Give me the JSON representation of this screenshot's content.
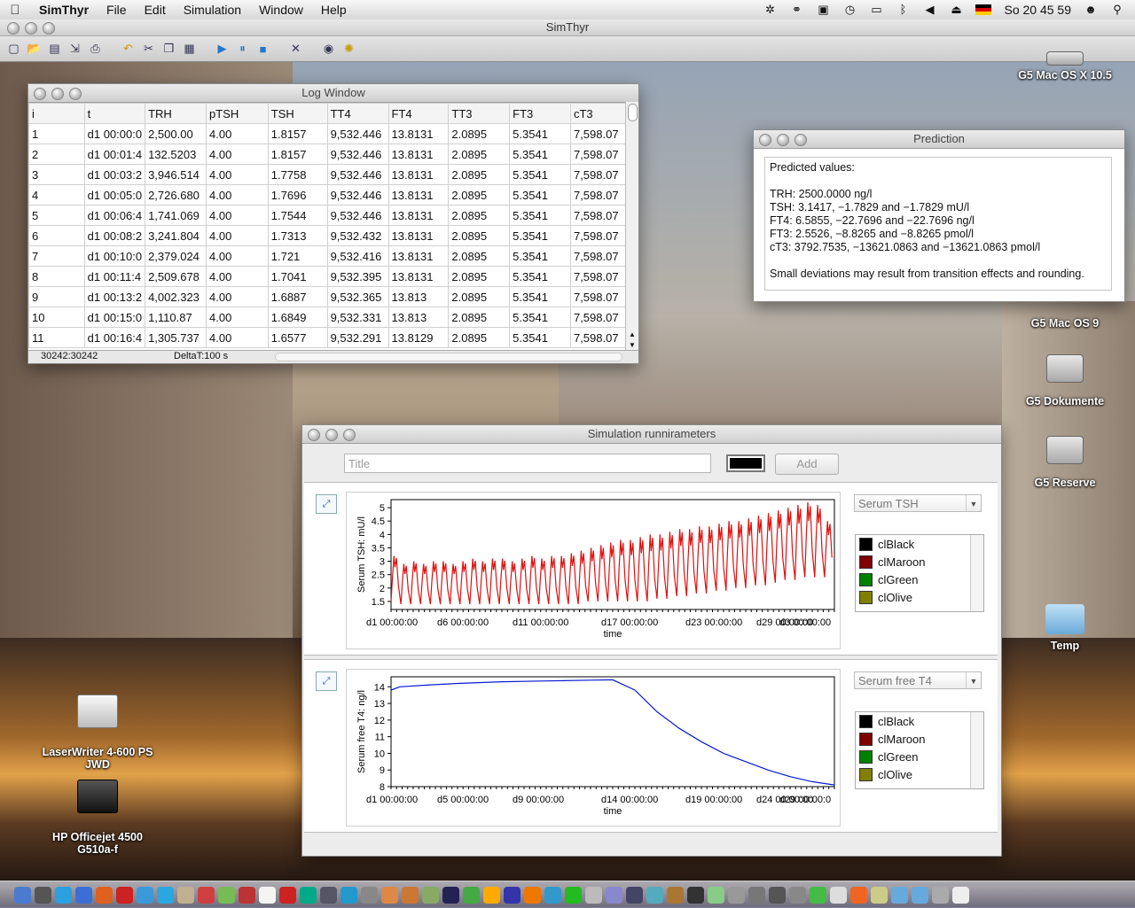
{
  "menubar": {
    "app_name": "SimThyr",
    "items": [
      "File",
      "Edit",
      "Simulation",
      "Window",
      "Help"
    ],
    "clock": "So 20 45 59",
    "icons": [
      "network-icon",
      "binoculars-icon",
      "memory-icon",
      "time-machine-icon",
      "display-icon",
      "bluetooth-icon",
      "volume-icon",
      "eject-icon",
      "flag-de-icon",
      "user-icon",
      "spotlight-icon"
    ]
  },
  "app_window": {
    "title": "SimThyr"
  },
  "toolbar": {
    "buttons": [
      "new-icon",
      "open-icon",
      "save-icon",
      "save-as-icon",
      "print-icon",
      "undo-icon",
      "cut-icon",
      "copy-icon",
      "paste-icon",
      "run-icon",
      "pause-icon",
      "stop-icon",
      "tools-icon",
      "help-icon",
      "settings-icon"
    ]
  },
  "log_window": {
    "title": "Log Window",
    "columns": [
      "i",
      "t",
      "TRH",
      "pTSH",
      "TSH",
      "TT4",
      "FT4",
      "TT3",
      "FT3",
      "cT3"
    ],
    "rows": [
      [
        "1",
        "d1 00:00:0",
        "2,500.00",
        "4.00",
        "1.8157",
        "9,532.446",
        "13.8131",
        "2.0895",
        "5.3541",
        "7,598.07"
      ],
      [
        "2",
        "d1 00:01:4",
        "132.5203",
        "4.00",
        "1.8157",
        "9,532.446",
        "13.8131",
        "2.0895",
        "5.3541",
        "7,598.07"
      ],
      [
        "3",
        "d1 00:03:2",
        "3,946.514",
        "4.00",
        "1.7758",
        "9,532.446",
        "13.8131",
        "2.0895",
        "5.3541",
        "7,598.07"
      ],
      [
        "4",
        "d1 00:05:0",
        "2,726.680",
        "4.00",
        "1.7696",
        "9,532.446",
        "13.8131",
        "2.0895",
        "5.3541",
        "7,598.07"
      ],
      [
        "5",
        "d1 00:06:4",
        "1,741.069",
        "4.00",
        "1.7544",
        "9,532.446",
        "13.8131",
        "2.0895",
        "5.3541",
        "7,598.07"
      ],
      [
        "6",
        "d1 00:08:2",
        "3,241.804",
        "4.00",
        "1.7313",
        "9,532.432",
        "13.8131",
        "2.0895",
        "5.3541",
        "7,598.07"
      ],
      [
        "7",
        "d1 00:10:0",
        "2,379.024",
        "4.00",
        "1.721",
        "9,532.416",
        "13.8131",
        "2.0895",
        "5.3541",
        "7,598.07"
      ],
      [
        "8",
        "d1 00:11:4",
        "2,509.678",
        "4.00",
        "1.7041",
        "9,532.395",
        "13.8131",
        "2.0895",
        "5.3541",
        "7,598.07"
      ],
      [
        "9",
        "d1 00:13:2",
        "4,002.323",
        "4.00",
        "1.6887",
        "9,532.365",
        "13.813",
        "2.0895",
        "5.3541",
        "7,598.07"
      ],
      [
        "10",
        "d1 00:15:0",
        "1,110.87",
        "4.00",
        "1.6849",
        "9,532.331",
        "13.813",
        "2.0895",
        "5.3541",
        "7,598.07"
      ],
      [
        "11",
        "d1 00:16:4",
        "1,305.737",
        "4.00",
        "1.6577",
        "9,532.291",
        "13.8129",
        "2.0895",
        "5.3541",
        "7,598.07"
      ]
    ],
    "status_left": "30242:30242",
    "status_right": "DeltaT:100 s"
  },
  "prediction_window": {
    "title": "Prediction",
    "text": "Predicted values:\n\nTRH: 2500.0000 ng/l\nTSH: 3.1417, −1.7829 and −1.7829 mU/l\nFT4: 6.5855, −22.7696 and −22.7696 ng/l\nFT3: 2.5526, −8.8265 and −8.8265 pmol/l\ncT3: 3792.7535, −13621.0863 and −13621.0863 pmol/l\n\nSmall deviations may result from transition effects and rounding."
  },
  "sim_window": {
    "title": "Simulation runnirameters",
    "title_placeholder": "Title",
    "add_label": "Add",
    "selected_color": "#000000",
    "color_options": [
      {
        "name": "clBlack",
        "color": "#000000"
      },
      {
        "name": "clMaroon",
        "color": "#800000"
      },
      {
        "name": "clGreen",
        "color": "#008000"
      },
      {
        "name": "clOlive",
        "color": "#808000"
      }
    ],
    "plot1": {
      "selector": "Serum TSH"
    },
    "plot2": {
      "selector": "Serum free T4"
    }
  },
  "chart_data": [
    {
      "type": "line",
      "title": "",
      "xlabel": "time",
      "ylabel": "Serum TSH: mU/l",
      "x_tick_labels": [
        "d1 00:00:00",
        "d6 00:00:00",
        "d11 00:00:00",
        "d17 00:00:00",
        "d23 00:00:00",
        "d29 00:00:00",
        "d3 00:00:00"
      ],
      "y_ticks": [
        1.5,
        2,
        2.5,
        3,
        3.5,
        4,
        4.5,
        5
      ],
      "ylim": [
        1.2,
        5.3
      ],
      "series": [
        {
          "color": "#e01010",
          "description": "oscillating daily, amplitude increasing over time",
          "minima": [
            1.5,
            1.4,
            1.4,
            1.4,
            1.4,
            1.4,
            1.4,
            1.4,
            1.4,
            1.4,
            1.4,
            1.4,
            1.4,
            1.4,
            1.4,
            1.4,
            1.4,
            1.4,
            1.4,
            1.4,
            1.5,
            1.5,
            1.5,
            1.5,
            1.5,
            1.5,
            1.5,
            1.6,
            1.6,
            1.7,
            1.7,
            1.8,
            1.8,
            1.9,
            1.9,
            2.0,
            2.0,
            2.1,
            2.1,
            2.2,
            2.3,
            2.3,
            2.4,
            2.4,
            2.4
          ],
          "maxima": [
            3.2,
            2.9,
            3.0,
            2.9,
            3.0,
            3.0,
            2.9,
            3.0,
            3.1,
            3.0,
            3.1,
            3.1,
            3.0,
            3.1,
            3.2,
            3.1,
            3.2,
            3.2,
            3.3,
            3.4,
            3.5,
            3.6,
            3.7,
            3.8,
            3.8,
            3.9,
            4.0,
            4.0,
            4.1,
            4.2,
            4.2,
            4.3,
            4.3,
            4.4,
            4.5,
            4.5,
            4.6,
            4.7,
            4.8,
            4.9,
            5.0,
            5.1,
            5.2,
            5.1,
            4.5
          ]
        }
      ]
    },
    {
      "type": "line",
      "title": "",
      "xlabel": "time",
      "ylabel": "Serum free T4: ng/l",
      "x_tick_labels": [
        "d1 00:00:00",
        "d5 00:00:00",
        "d9 00:00:00",
        "d14 00:00:00",
        "d19 00:00:00",
        "d24 00:00:00",
        "d29 00:00:0"
      ],
      "y_ticks": [
        8,
        9,
        10,
        11,
        12,
        13,
        14
      ],
      "ylim": [
        8,
        14.6
      ],
      "series": [
        {
          "color": "#0a1ad0",
          "x": [
            0,
            0.02,
            0.08,
            0.15,
            0.25,
            0.35,
            0.45,
            0.5,
            0.55,
            0.6,
            0.65,
            0.7,
            0.75,
            0.8,
            0.85,
            0.9,
            0.95,
            1.0
          ],
          "y": [
            13.8,
            14.0,
            14.1,
            14.2,
            14.3,
            14.35,
            14.4,
            14.42,
            13.8,
            12.5,
            11.5,
            10.7,
            10.0,
            9.5,
            9.0,
            8.6,
            8.3,
            8.1
          ]
        }
      ]
    }
  ],
  "desktop_icons": [
    {
      "label": "G5 Mac OS X 10.5"
    },
    {
      "label": "G5 Mac OS 9"
    },
    {
      "label": "G5 Dokumente"
    },
    {
      "label": "G5 Reserve"
    },
    {
      "label": "Temp"
    },
    {
      "label": "LaserWriter 4-600 PS\nJWD"
    },
    {
      "label": "HP Officejet 4500\nG510a-f"
    }
  ]
}
